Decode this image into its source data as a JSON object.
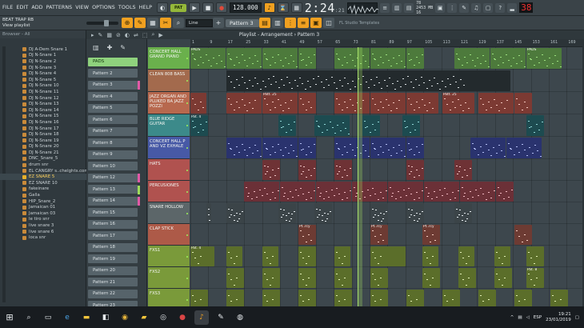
{
  "menu": [
    "FILE",
    "EDIT",
    "ADD",
    "PATTERNS",
    "VIEW",
    "OPTIONS",
    "TOOLS",
    "HELP"
  ],
  "transport": {
    "pat_label": "PAT",
    "tempo": "128.000",
    "time_main": "2:24",
    "time_sub": ":21",
    "time_label": "M:S:CS",
    "mem_top": "78",
    "mem_mid": "2453 MB",
    "mem_bot": "16",
    "cpu": "38"
  },
  "hint": {
    "line1": "BEAT TRAP RB",
    "line2": "View playlist"
  },
  "toolbar2": {
    "snap": "Line",
    "pattern": "Pattern 3",
    "news": "FL Studio Templates"
  },
  "browser": {
    "header": "Browser - All",
    "items": [
      "DJ A-Dem Snare 1",
      "DJ N-Snare 1",
      "DJ N-Snare 2",
      "DJ N-Snare 3",
      "DJ N-Snare 4",
      "DJ N-Snare 5",
      "DJ N-Snare 10",
      "DJ N-Snare 11",
      "DJ N-Snare 12",
      "DJ N-Snare 13",
      "DJ N-Snare 14",
      "DJ N-Snare 15",
      "DJ N-Snare 16",
      "DJ N-Snare 17",
      "DJ N-Snare 18",
      "DJ N-Snare 19",
      "DJ N-Snare 20",
      "DJ N-Snare 21",
      "DNC_Snare_5",
      "drum snr",
      "EL CANGRY s..chelghts.com",
      "EZ SNARE 5",
      "EZ SNARE 10",
      "fakeinare",
      "Galla",
      "HIP_Snare_2",
      "Jamaican 01",
      "Jamaican 03",
      "le tiro snr",
      "live snare 3",
      "live snare 6",
      "loca snr"
    ]
  },
  "playlist": {
    "title": "Playlist - Arrangement › Pattern 3",
    "patterns": [
      "PADS",
      "Pattern 2",
      "Pattern 3",
      "Pattern 4",
      "Pattern 5",
      "Pattern 6",
      "Pattern 7",
      "Pattern 8",
      "Pattern 9",
      "Pattern 10",
      "Pattern 12",
      "Pattern 13",
      "Pattern 14",
      "Pattern 15",
      "Pattern 16",
      "Pattern 17",
      "Pattern 18",
      "Pattern 19",
      "Pattern 20",
      "Pattern 21",
      "Pattern 22",
      "Pattern 23"
    ],
    "ruler": [
      "1",
      "9",
      "17",
      "25",
      "33",
      "41",
      "49",
      "57",
      "65",
      "73",
      "81",
      "89",
      "97",
      "105",
      "113",
      "121",
      "129",
      "137",
      "145",
      "153",
      "161",
      "169"
    ],
    "tracks": [
      {
        "name": "CONCERT HALL GRAND PIANO",
        "color": "#6ab04c"
      },
      {
        "name": "CLEAN 808 BASS",
        "color": "#a36a4d"
      },
      {
        "name": "JAZZ ORGAN AND PLUKED BA JAZZ POZZI",
        "color": "#b7684e"
      },
      {
        "name": "BLUE RIDGE GUITAR",
        "color": "#3c8a8a"
      },
      {
        "name": "CONCERT HALL P AND VZ EXHALE",
        "color": "#4759a6"
      },
      {
        "name": "HATS",
        "color": "#b0524f"
      },
      {
        "name": "PERCUSIONES",
        "color": "#b0524f"
      },
      {
        "name": "SNARE HOLLOW",
        "color": "#5c6669"
      },
      {
        "name": "CLAP STICK",
        "color": "#ad5a48"
      },
      {
        "name": "FXS1",
        "color": "#7a9a3a"
      },
      {
        "name": "FXS2",
        "color": "#7a9a3a"
      },
      {
        "name": "FXS3",
        "color": "#7a9a3a"
      }
    ],
    "clip_labels": {
      "pads": "PADS",
      "patt": "Patt. 25",
      "pat6": "Pattern 6",
      "fx": "Pat. 4",
      "fx2": "Pat. 8",
      "cl": "Pt..rcy"
    }
  },
  "taskbar": {
    "time": "19:21",
    "date": "23/01/2019",
    "lang": "ESP"
  }
}
